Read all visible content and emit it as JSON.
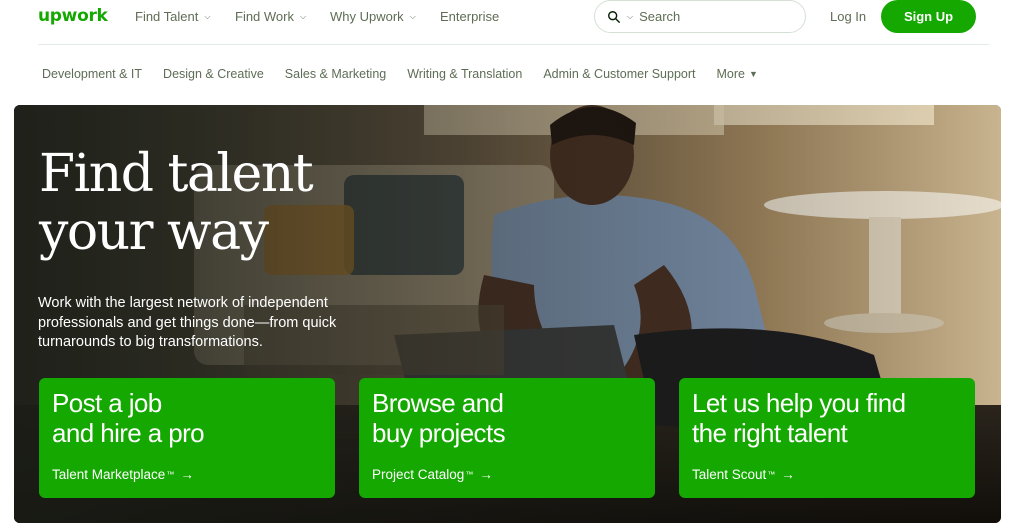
{
  "brand": {
    "logo_text": "upwork",
    "color": "#14a800"
  },
  "topnav": {
    "items": [
      {
        "label": "Find Talent",
        "has_dropdown": true
      },
      {
        "label": "Find Work",
        "has_dropdown": true
      },
      {
        "label": "Why Upwork",
        "has_dropdown": true
      },
      {
        "label": "Enterprise",
        "has_dropdown": false
      }
    ],
    "search": {
      "placeholder": "Search",
      "icon": "search-icon"
    },
    "login_label": "Log In",
    "signup_label": "Sign Up"
  },
  "categories": {
    "items": [
      "Development & IT",
      "Design & Creative",
      "Sales & Marketing",
      "Writing & Translation",
      "Admin & Customer Support"
    ],
    "more_label": "More"
  },
  "hero": {
    "title": "Find talent\nyour way",
    "subtitle": "Work with the largest network of independent professionals and get things done—from quick turnarounds to big transformations.",
    "cards": [
      {
        "title": "Post a job\nand hire a pro",
        "link": "Talent Marketplace",
        "tm": "™"
      },
      {
        "title": "Browse and\nbuy projects",
        "link": "Project Catalog",
        "tm": "™"
      },
      {
        "title": "Let us help you find\nthe right talent",
        "link": "Talent Scout",
        "tm": "™"
      }
    ]
  }
}
